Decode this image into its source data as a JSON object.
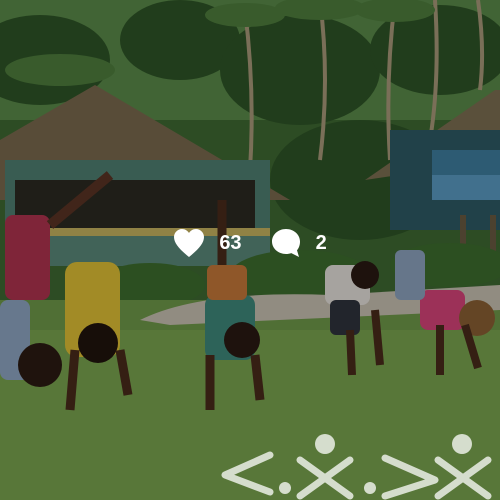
{
  "post": {
    "likes": "63",
    "comments": "2"
  },
  "icons": {
    "like": "heart-icon",
    "comment": "speech-bubble-icon"
  },
  "colors": {
    "overlay_text": "#ffffff",
    "overlay_tint": "rgba(0,0,0,0.28)"
  }
}
